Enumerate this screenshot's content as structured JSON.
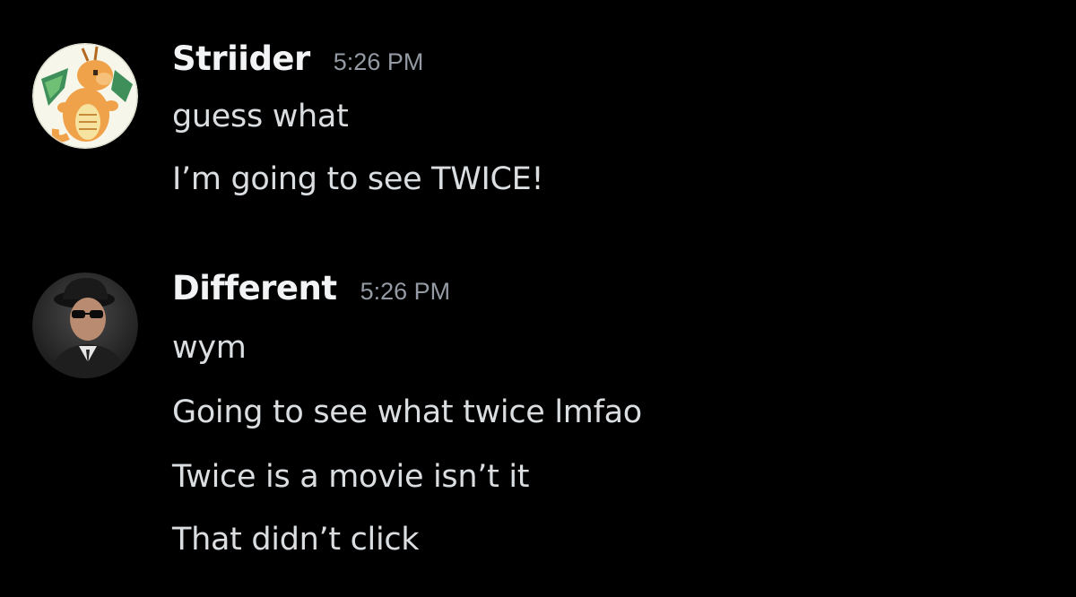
{
  "messages": [
    {
      "username": "Striider",
      "timestamp": "5:26 PM",
      "avatar_icon": "dragonite-pixel-avatar",
      "lines": [
        "guess what",
        "I’m going to see TWICE!"
      ]
    },
    {
      "username": "Different",
      "timestamp": "5:26 PM",
      "avatar_icon": "man-in-sunglasses-avatar",
      "lines": [
        "wym",
        "Going to see what twice lmfao",
        "Twice is a movie isn’t it",
        "That didn’t click"
      ]
    }
  ],
  "colors": {
    "background": "#000000",
    "username": "#f2f3f5",
    "timestamp": "#949ba4",
    "message_text": "#dbdee1"
  }
}
